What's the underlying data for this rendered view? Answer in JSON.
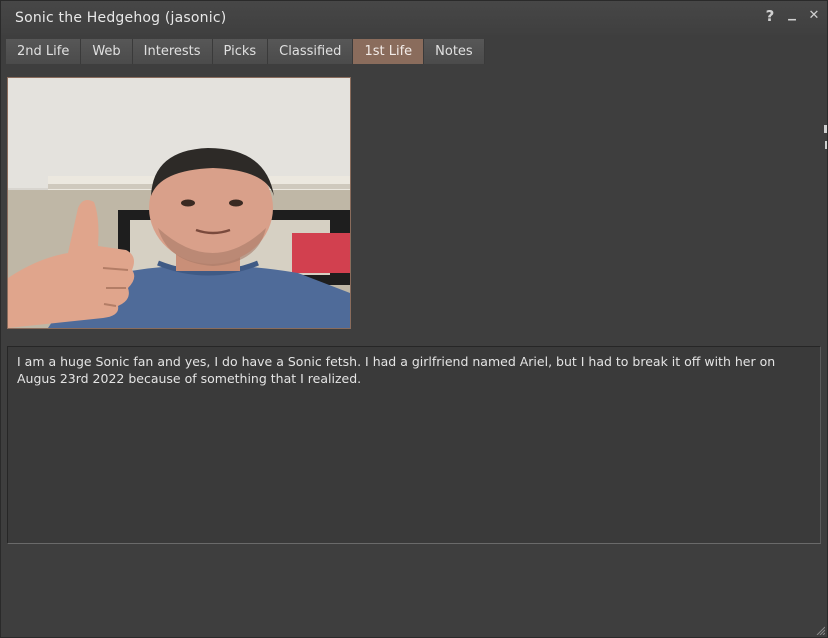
{
  "window": {
    "title": "Sonic the Hedgehog (jasonic)",
    "controls": {
      "help": "?",
      "minimize": "▁",
      "close": "✕"
    }
  },
  "tabs": [
    {
      "label": "2nd Life",
      "active": false
    },
    {
      "label": "Web",
      "active": false
    },
    {
      "label": "Interests",
      "active": false
    },
    {
      "label": "Picks",
      "active": false
    },
    {
      "label": "Classified",
      "active": false
    },
    {
      "label": "1st Life",
      "active": true
    },
    {
      "label": "Notes",
      "active": false
    }
  ],
  "first_life": {
    "photo_icon": "profile-photo",
    "about_text": "I am a huge Sonic fan and yes, I do have a Sonic fetsh. I had a girlfriend named Ariel, but I had to break it off with her on Augus 23rd 2022 because of something that I realized."
  },
  "colors": {
    "accent_tab": "#8a6c5c",
    "background": "#3e3e3e"
  }
}
